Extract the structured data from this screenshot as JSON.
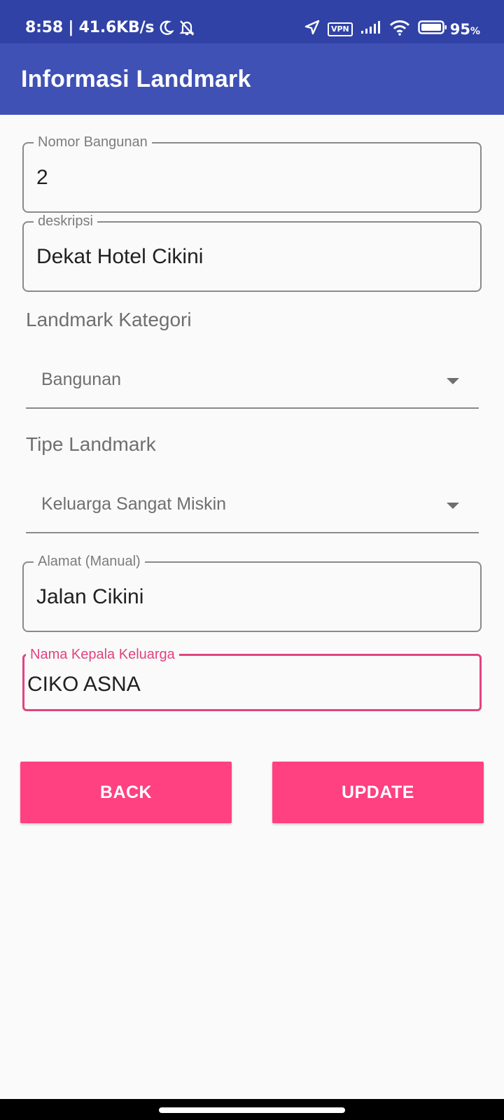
{
  "status_bar": {
    "time_speed": "8:58 | 41.6KB/s",
    "vpn_label": "VPN",
    "battery_percent": "95",
    "battery_unit": "%"
  },
  "app_bar": {
    "title": "Informasi Landmark"
  },
  "fields": {
    "nomor_bangunan": {
      "label": "Nomor Bangunan",
      "value": "2"
    },
    "deskripsi": {
      "label": "deskripsi",
      "value": "Dekat Hotel Cikini"
    },
    "landmark_kategori": {
      "label": "Landmark Kategori",
      "selected": "Bangunan"
    },
    "tipe_landmark": {
      "label": "Tipe Landmark",
      "selected": "Keluarga Sangat Miskin"
    },
    "alamat": {
      "label": "Alamat (Manual)",
      "value": "Jalan Cikini"
    },
    "nama_kepala_keluarga": {
      "label": "Nama Kepala Keluarga",
      "value": "CIKO ASNA"
    }
  },
  "buttons": {
    "back": "BACK",
    "update": "UPDATE"
  },
  "colors": {
    "primary": "#3f51b5",
    "primary_dark": "#3042a6",
    "accent": "#ff4081",
    "focus": "#e0447f"
  },
  "icons": [
    "moon-icon",
    "bell-off-icon",
    "location-arrow-icon",
    "signal-icon",
    "wifi-icon",
    "battery-icon",
    "dropdown-arrow-icon"
  ]
}
